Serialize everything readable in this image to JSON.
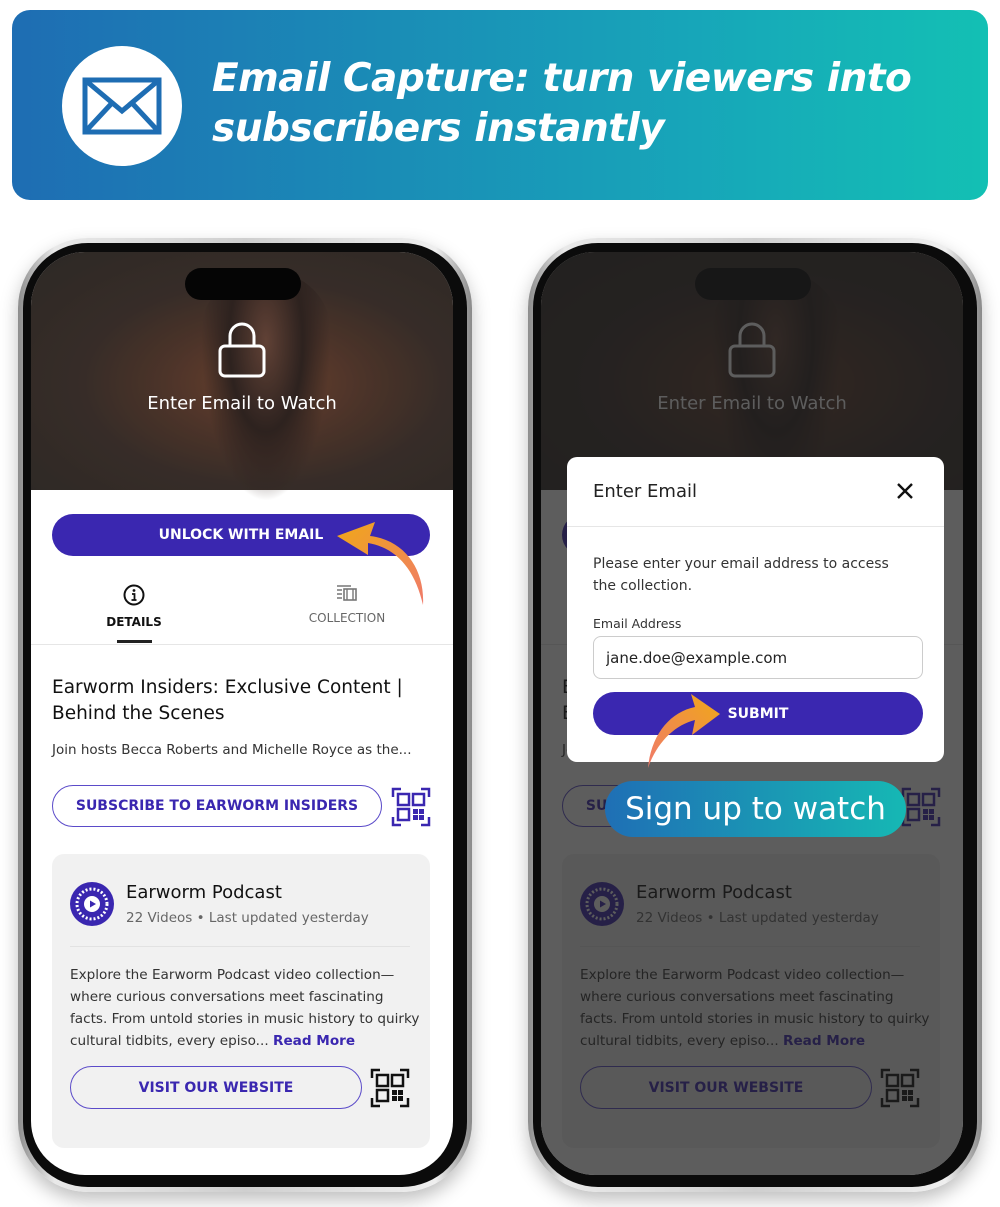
{
  "banner": {
    "title_line1": "Email Capture: turn viewers into",
    "title_line2": "subscribers instantly",
    "icon": "envelope-icon",
    "gradient": [
      "#1e6db3",
      "#13c0b4"
    ]
  },
  "screen": {
    "video_overlay_text": "Enter Email to Watch",
    "unlock_button": "UNLOCK WITH EMAIL",
    "tabs": [
      {
        "label": "DETAILS",
        "icon": "info-icon",
        "active": true
      },
      {
        "label": "COLLECTION",
        "icon": "collection-icon",
        "active": false
      }
    ],
    "content_title": "Earworm Insiders: Exclusive Content | Behind the Scenes",
    "content_description": "Join hosts Becca Roberts and Michelle Royce as the...",
    "subscribe_button": "SUBSCRIBE TO EARWORM INSIDERS",
    "card": {
      "title": "Earworm Podcast",
      "videos": "22 Videos",
      "updated": "Last updated yesterday",
      "avatar_text": "EARWORM PODCAST",
      "description": "Explore the Earworm Podcast video collection—where curious conversations meet fascinating facts. From untold stories in music history to quirky cultural tidbits, every episo...",
      "read_more": "Read More",
      "visit_button": "VISIT OUR WEBSITE"
    }
  },
  "modal": {
    "title": "Enter Email",
    "text": "Please enter your email address to access the collection.",
    "label": "Email Address",
    "email_value": "jane.doe@example.com",
    "submit": "SUBMIT"
  },
  "callout": "Sign up to watch",
  "colors": {
    "accent": "#3a27b0",
    "arrow": [
      "#f0a818",
      "#f07a6a"
    ]
  }
}
